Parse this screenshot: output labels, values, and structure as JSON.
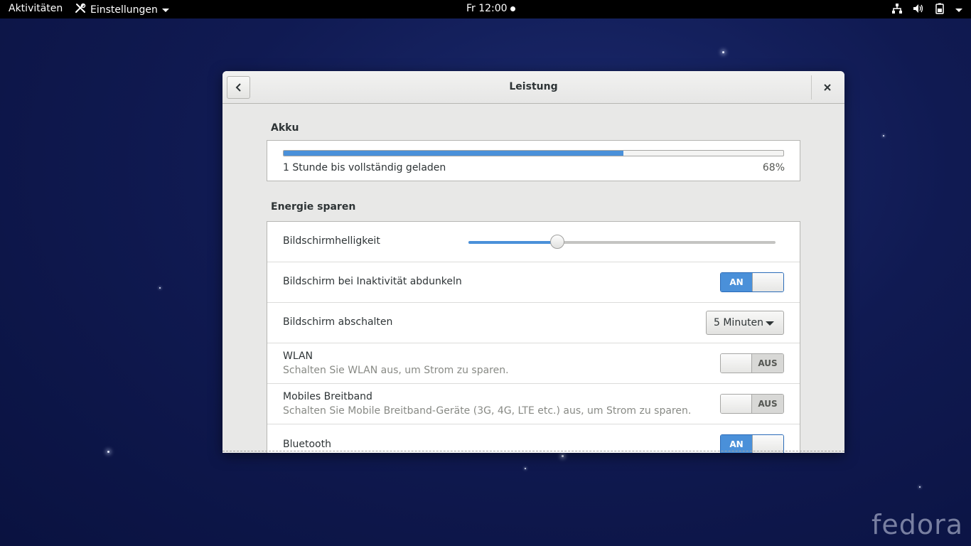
{
  "topbar": {
    "activities": "Aktivitäten",
    "app_menu": "Einstellungen",
    "clock": "Fr 12:00"
  },
  "window": {
    "title": "Leistung"
  },
  "battery": {
    "heading": "Akku",
    "status": "1 Stunde bis vollständig geladen",
    "percent_label": "68%",
    "level": 0.68
  },
  "power_saving": {
    "heading": "Energie sparen",
    "brightness": {
      "label": "Bildschirmhelligkeit",
      "level": 0.29
    },
    "dim_screen": {
      "label": "Bildschirm bei Inaktivität abdunkeln",
      "state": "AN"
    },
    "blank_screen": {
      "label": "Bildschirm abschalten",
      "value": "5 Minuten"
    },
    "wifi": {
      "label": "WLAN",
      "description": "Schalten Sie WLAN aus, um Strom zu sparen.",
      "state": "AUS"
    },
    "mobile": {
      "label": "Mobiles Breitband",
      "description": "Schalten Sie Mobile Breitband-Geräte (3G, 4G, LTE etc.) aus, um Strom zu sparen.",
      "state": "AUS"
    },
    "bluetooth": {
      "label": "Bluetooth",
      "state": "AN"
    }
  },
  "wallpaper": {
    "logo_text": "fedora"
  },
  "colors": {
    "accent": "#4a90d9",
    "topbar": "#000000"
  }
}
